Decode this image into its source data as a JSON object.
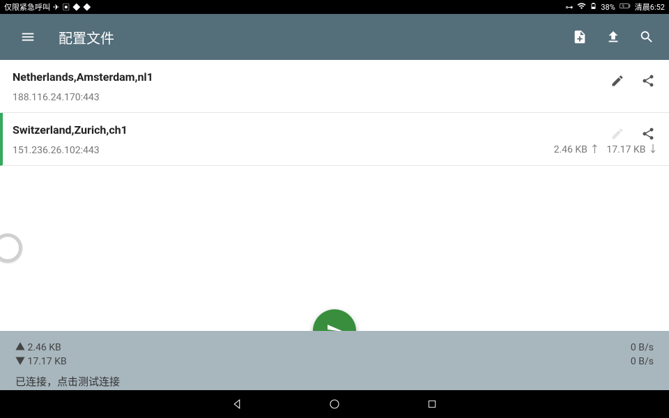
{
  "statusbar": {
    "left_text": "仅限紧急呼叫",
    "battery": "38%",
    "time": "清晨6:52"
  },
  "appbar": {
    "title": "配置文件"
  },
  "profiles": [
    {
      "title": "Netherlands,Amsterdam,nl1",
      "address": "188.116.24.170:443",
      "selected": false,
      "edit_enabled": true,
      "upload": "",
      "download": ""
    },
    {
      "title": "Switzerland,Zurich,ch1",
      "address": "151.236.26.102:443",
      "selected": true,
      "edit_enabled": false,
      "upload": "2.46 KB ↑",
      "download": "17.17 KB ↓"
    }
  ],
  "footer": {
    "upload": "▲ 2.46 KB",
    "download": "▼ 17.17 KB",
    "rate1": "0 B/s",
    "rate2": "0 B/s",
    "status": "已连接，点击测试连接"
  }
}
